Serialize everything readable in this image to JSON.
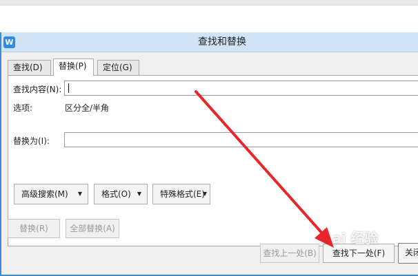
{
  "dialog": {
    "title": "查找和替换",
    "app_icon": "W"
  },
  "tabs": [
    "查找(D)",
    "替换(P)",
    "定位(G)"
  ],
  "find": {
    "label": "查找内容(N):",
    "value": ""
  },
  "options": {
    "label": "选项:",
    "value": "区分全/半角"
  },
  "replace": {
    "label": "替换为(I):",
    "value": ""
  },
  "buttons": {
    "advanced": "高级搜索(M)",
    "format": "格式(O)",
    "special": "特殊格式(E)",
    "replace": "替换(R)",
    "replace_all": "全部替换(A)",
    "find_prev": "查找上一处(B)",
    "find_next": "查找下一处(F)",
    "close": "关闭"
  },
  "watermark": "Bai 经验",
  "colors": {
    "annotation_arrow": "#e8262a",
    "titlebar": "#cfe4f7",
    "accent": "#3d8bd6"
  }
}
